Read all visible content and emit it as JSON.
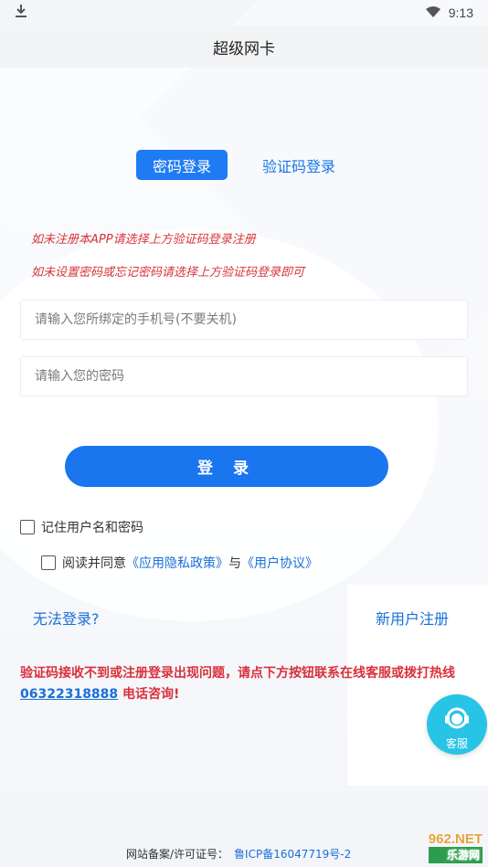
{
  "status_bar": {
    "time": "9:13"
  },
  "header": {
    "title": "超级网卡"
  },
  "tabs": [
    {
      "label": "密码登录",
      "active": true
    },
    {
      "label": "验证码登录",
      "active": false
    }
  ],
  "notices": [
    "如未注册本APP请选择上方验证码登录注册",
    "如未设置密码或忘记密码请选择上方验证码登录即可"
  ],
  "form": {
    "phone_placeholder": "请输入您所绑定的手机号(不要关机)",
    "password_placeholder": "请输入您的密码",
    "login_label": "登 录",
    "remember_label": "记住用户名和密码",
    "agree_prefix": "阅读并同意",
    "privacy_link": "《应用隐私政策》",
    "agree_and": "与",
    "user_agreement_link": "《用户协议》"
  },
  "links": {
    "cant_login": "无法登录?",
    "register": "新用户注册"
  },
  "warning": {
    "text_before": "验证码接收不到或注册登录出现问题，请点下方按钮联系在线客服或拨打热线 ",
    "phone": "06322318888",
    "text_after": " 电话咨询!"
  },
  "service_button": {
    "label": "客服"
  },
  "footer": {
    "label": "网站备案/许可证号：",
    "icp": "鲁ICP备16047719号-2"
  },
  "watermark": {
    "main": "962.NET",
    "sub": "乐游网"
  },
  "colors": {
    "primary": "#1a76ee",
    "warning": "#d9303b",
    "service": "#28c4e6"
  }
}
